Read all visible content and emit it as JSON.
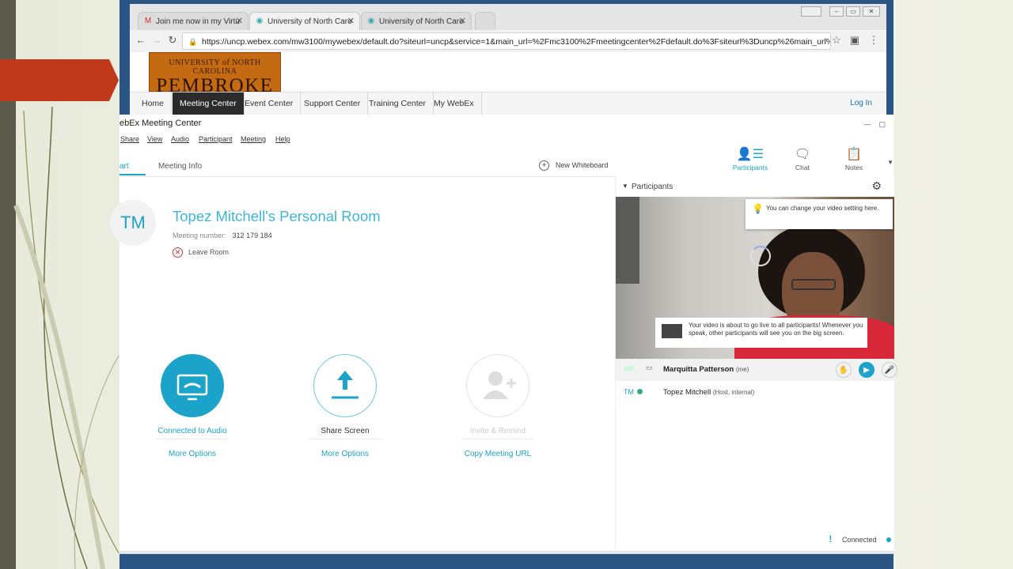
{
  "browser": {
    "tabs": [
      {
        "label": "Join me now in my Virtu",
        "favicon": "gmail-icon",
        "active": false
      },
      {
        "label": "University of North Caro",
        "favicon": "webex-icon",
        "active": true
      },
      {
        "label": "University of North Caro",
        "favicon": "webex-icon",
        "active": false
      }
    ],
    "url": "https://uncp.webex.com/mw3100/mywebex/default.do?siteurl=uncp&service=1&main_url=%2Fmc3100%2Fmeetingcenter%2Fdefault.do%3Fsiteurl%3Duncp%26main_url%3D%"
  },
  "site": {
    "logo_line1": "UNIVERSITY of NORTH CAROLINA",
    "logo_line2": "PEMBROKE",
    "nav": [
      "Home",
      "Meeting Center",
      "Event Center",
      "Support Center",
      "Training Center",
      "My WebEx"
    ],
    "active_nav": "Meeting Center",
    "login": "Log In"
  },
  "webex": {
    "title": "ebEx Meeting Center",
    "menu": [
      "Share",
      "View",
      "Audio",
      "Participant",
      "Meeting",
      "Help"
    ],
    "tabs": {
      "start": "art",
      "info": "Meeting Info"
    },
    "new_whiteboard": "New Whiteboard",
    "panels": [
      {
        "label": "Participants",
        "icon": "participants-icon",
        "active": true
      },
      {
        "label": "Chat",
        "icon": "chat-icon",
        "active": false
      },
      {
        "label": "Notes",
        "icon": "notes-icon",
        "active": false
      }
    ],
    "room": {
      "avatar": "TM",
      "title": "Topez Mitchell's Personal Room",
      "meeting_number_label": "Meeting number:",
      "meeting_number": "312 179 184",
      "leave": "Leave Room"
    },
    "actions": [
      {
        "label": "Connected to Audio",
        "more": "More Options"
      },
      {
        "label": "Share Screen",
        "more": "More Options"
      },
      {
        "label": "Invite & Remind",
        "more": "Copy Meeting URL"
      }
    ],
    "participants_panel": {
      "title": "Participants",
      "tip_video_setting": "You can change your video setting here.",
      "tip_going_live": "Your video is about to go live to all participants! Whenever you speak, other participants will see you on the big screen.",
      "people": [
        {
          "initials": "MP",
          "name": "Marquitta Patterson",
          "role": "(me)"
        },
        {
          "initials": "TM",
          "name": "Topez Mitchell",
          "role": "(Host, internal)"
        }
      ]
    },
    "status": "Connected"
  },
  "colors": {
    "accent": "#1ba3c9",
    "nav_active": "#2b2b2b",
    "logo": "#c36a12"
  }
}
